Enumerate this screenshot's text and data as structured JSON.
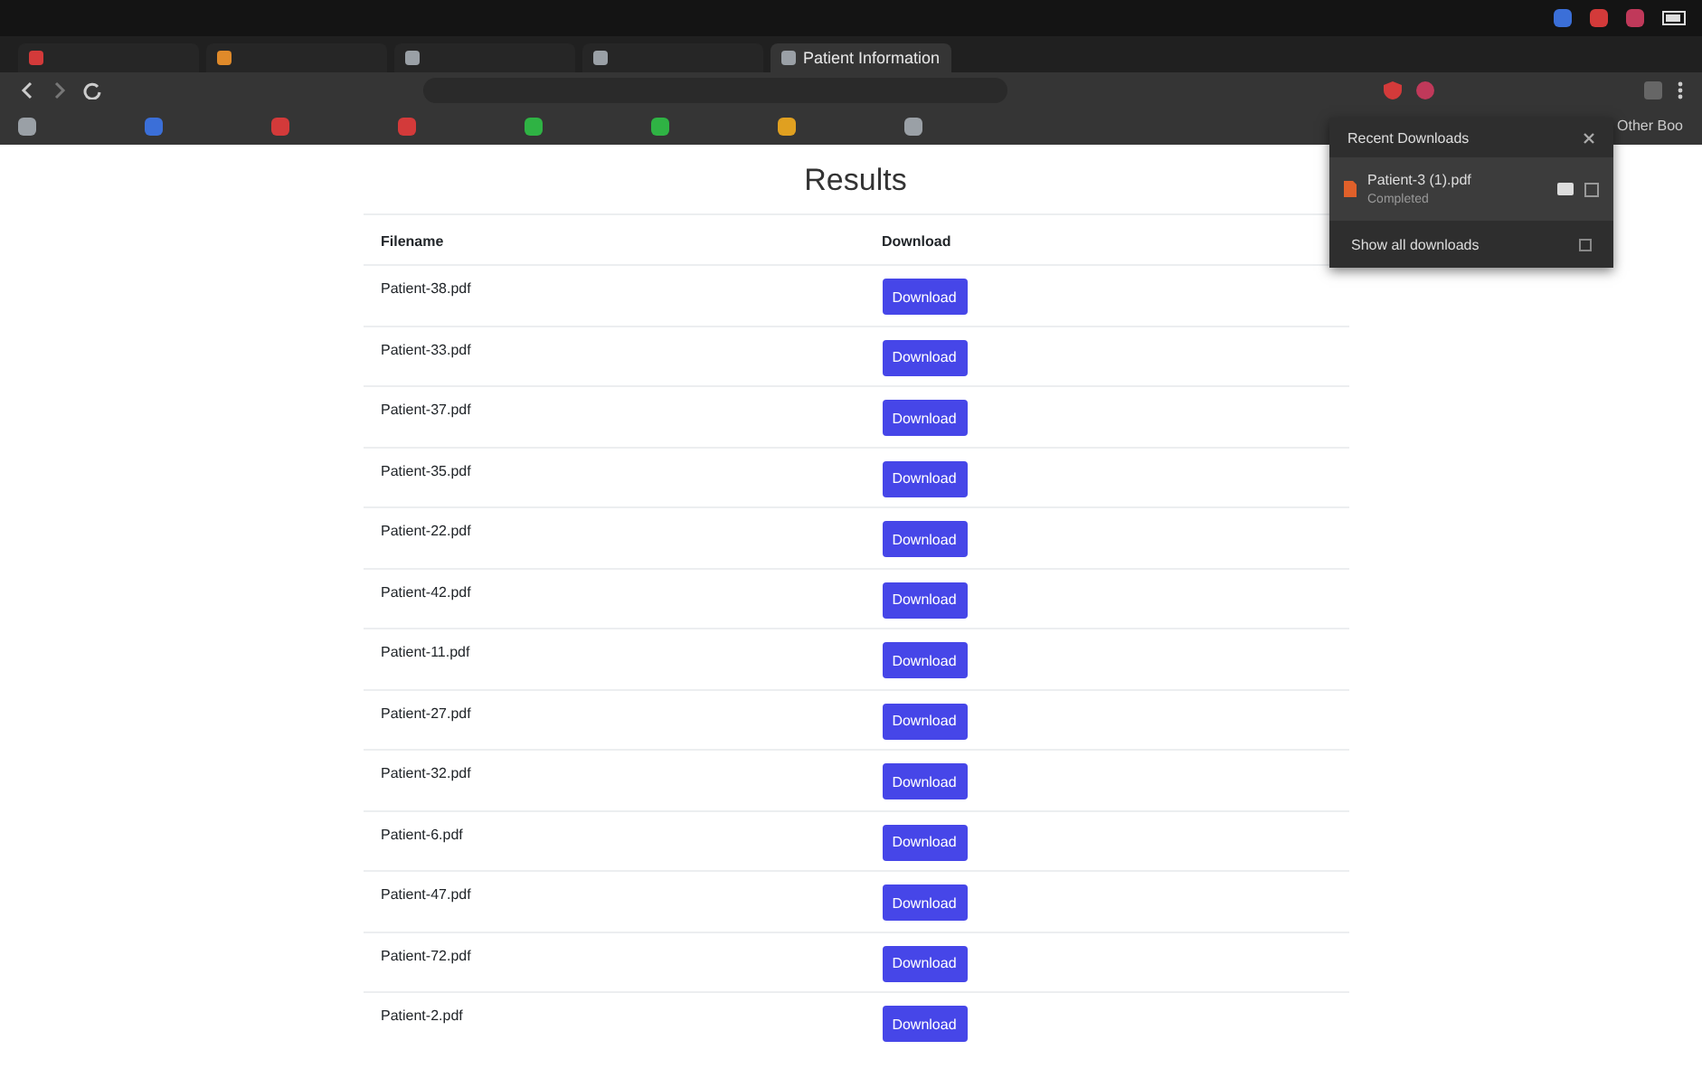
{
  "browser": {
    "tabs": [
      {
        "color": "#d33a3a",
        "selected": false
      },
      {
        "color": "#e08a2a",
        "selected": false
      },
      {
        "color": "#9aa0a6",
        "selected": false
      },
      {
        "color": "#9aa0a6",
        "selected": false
      },
      {
        "color": "#9aa0a6",
        "title": "Patient Information",
        "selected": true
      }
    ],
    "bookmarks": [
      {
        "color": "#9aa0a6"
      },
      {
        "color": "#3b6fd8"
      },
      {
        "color": "#d33a3a"
      },
      {
        "color": "#d33a3a"
      },
      {
        "color": "#2fb344"
      },
      {
        "color": "#2fb344"
      },
      {
        "color": "#e0a020"
      },
      {
        "color": "#9aa0a6"
      }
    ],
    "other_bookmarks": "Other Boo"
  },
  "page": {
    "title": "Results",
    "columns": [
      "Filename",
      "Download"
    ],
    "rows": [
      {
        "filename": "Patient-38.pdf",
        "action": "Download"
      },
      {
        "filename": "Patient-33.pdf",
        "action": "Download"
      },
      {
        "filename": "Patient-37.pdf",
        "action": "Download"
      },
      {
        "filename": "Patient-35.pdf",
        "action": "Download"
      },
      {
        "filename": "Patient-22.pdf",
        "action": "Download"
      },
      {
        "filename": "Patient-42.pdf",
        "action": "Download"
      },
      {
        "filename": "Patient-11.pdf",
        "action": "Download"
      },
      {
        "filename": "Patient-27.pdf",
        "action": "Download"
      },
      {
        "filename": "Patient-32.pdf",
        "action": "Download"
      },
      {
        "filename": "Patient-6.pdf",
        "action": "Download"
      },
      {
        "filename": "Patient-47.pdf",
        "action": "Download"
      },
      {
        "filename": "Patient-72.pdf",
        "action": "Download"
      },
      {
        "filename": "Patient-2.pdf",
        "action": "Download"
      }
    ]
  },
  "downloads_popup": {
    "title": "Recent Downloads",
    "items": [
      {
        "name": "Patient-3 (1).pdf",
        "status": "Completed"
      }
    ],
    "show_all": "Show all downloads"
  }
}
